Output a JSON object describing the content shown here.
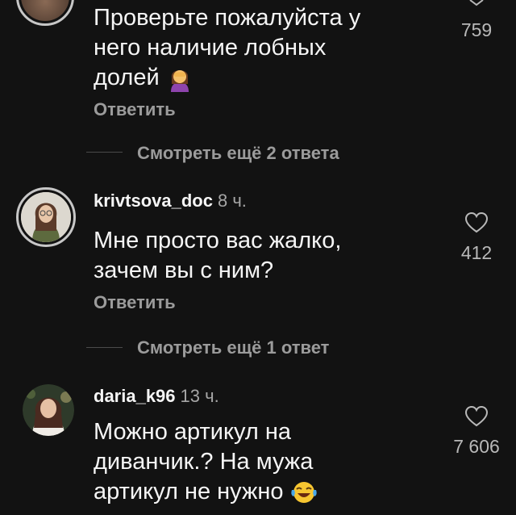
{
  "comments": [
    {
      "text_lines": [
        "Проверьте пожалуйста у",
        "него наличие лобных",
        "долей"
      ],
      "emoji": "woman-facepalming-emoji",
      "reply_label": "Ответить",
      "likes": "759"
    },
    {
      "username": "krivtsova_doc",
      "time": "8 ч.",
      "text_lines": [
        "Мне просто вас жалко,",
        "зачем вы с ним?"
      ],
      "reply_label": "Ответить",
      "likes": "412"
    },
    {
      "username": "daria_k96",
      "time": "13 ч.",
      "text_lines": [
        "Можно артикул на",
        "диванчик.? На мужа",
        "артикул не нужно"
      ],
      "emoji": "laughing-tears-emoji",
      "likes": "7 606"
    }
  ],
  "view_more": [
    "Смотреть ещё 2 ответа",
    "Смотреть ещё 1 ответ"
  ],
  "colors": {
    "background": "#121212",
    "text": "#f5f5f5",
    "secondary": "#9b9b9b"
  }
}
